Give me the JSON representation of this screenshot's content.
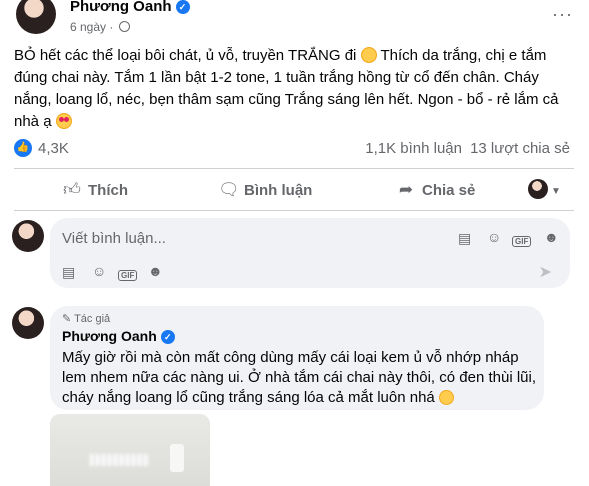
{
  "post": {
    "author": "Phương Oanh",
    "time": "6 ngày",
    "more": "···",
    "text_part1": "BỎ hết các thể loại bôi chát, ủ vỗ, truyền TRẮNG đi",
    "text_part2": "Thích da trắng, chị e tắm đúng chai này. Tắm 1 lần bật 1-2 tone, 1 tuần trắng hồng từ cổ đến chân. Cháy nắng, loang lổ, néc, bẹn thâm sạm cũng Trắng sáng lên hết. Ngon - bổ - rẻ lắm cả nhà ạ"
  },
  "stats": {
    "likes": "4,3K",
    "comments": "1,1K bình luận",
    "shares": "13 lượt chia sẻ"
  },
  "actions": {
    "like": "Thích",
    "comment": "Bình luận",
    "share": "Chia sẻ"
  },
  "composer": {
    "placeholder": "Viết bình luận...",
    "gif": "GIF"
  },
  "reply": {
    "tag": "Tác giả",
    "author": "Phương Oanh",
    "text": "Mấy giờ rồi mà còn mất công dùng mấy cái loại kem ủ vỗ nhớp nháp lem nhem nữa các nàng ui. Ở nhà tắm cái chai này thôi, có đen thùi lũi, cháy nắng loang lổ cũng trắng sáng lóa cả mắt luôn nhá"
  },
  "colors": {
    "accent": "#1877f2",
    "secondary_text": "#65676b",
    "bubble": "#f0f2f5"
  },
  "icons": [
    "globe-icon",
    "more-icon",
    "like-icon",
    "comment-icon",
    "share-icon",
    "sticker-icon",
    "emoji-icon",
    "gif-icon",
    "camera-icon",
    "send-icon",
    "pencil-icon",
    "verified-icon"
  ]
}
